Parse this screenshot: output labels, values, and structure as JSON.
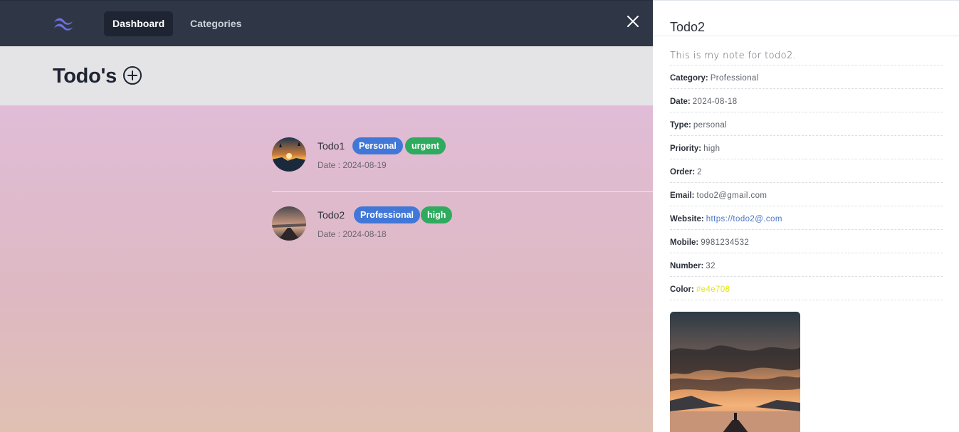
{
  "nav": {
    "items": [
      {
        "label": "Dashboard",
        "active": true
      },
      {
        "label": "Categories",
        "active": false
      }
    ]
  },
  "header": {
    "title": "Todo's"
  },
  "todos": [
    {
      "name": "Todo1",
      "badges": [
        {
          "label": "Personal",
          "color": "#4178d8"
        },
        {
          "label": "urgent",
          "color": "#2fab5f"
        }
      ],
      "date": "Date : 2024-08-19"
    },
    {
      "name": "Todo2",
      "badges": [
        {
          "label": "Professional",
          "color": "#4178d8"
        },
        {
          "label": "high",
          "color": "#2fab5f"
        }
      ],
      "date": "Date : 2024-08-18"
    }
  ],
  "panel": {
    "title": "Todo2",
    "note": "This is my note for todo2.",
    "details": [
      {
        "key": "Category:",
        "value": "Professional"
      },
      {
        "key": "Date:",
        "value": "2024-08-18"
      },
      {
        "key": "Type:",
        "value": "personal"
      },
      {
        "key": "Priority:",
        "value": "high"
      },
      {
        "key": "Order:",
        "value": "2"
      },
      {
        "key": "Email:",
        "value": "todo2@gmail.com"
      },
      {
        "key": "Website:",
        "value": "https://todo2@.com"
      },
      {
        "key": "Mobile:",
        "value": "9981234532"
      },
      {
        "key": "Number:",
        "value": "32"
      },
      {
        "key": "Color:",
        "value": "#e4e708"
      }
    ]
  },
  "colors": {
    "nav_bg": "#2f3746",
    "badge_blue": "#4178d8",
    "badge_green": "#2fab5f",
    "link": "#4a78c9",
    "todo_color": "#e4e708"
  },
  "icons": [
    "tailwind-logo-icon",
    "close-icon",
    "add-circle-icon"
  ]
}
